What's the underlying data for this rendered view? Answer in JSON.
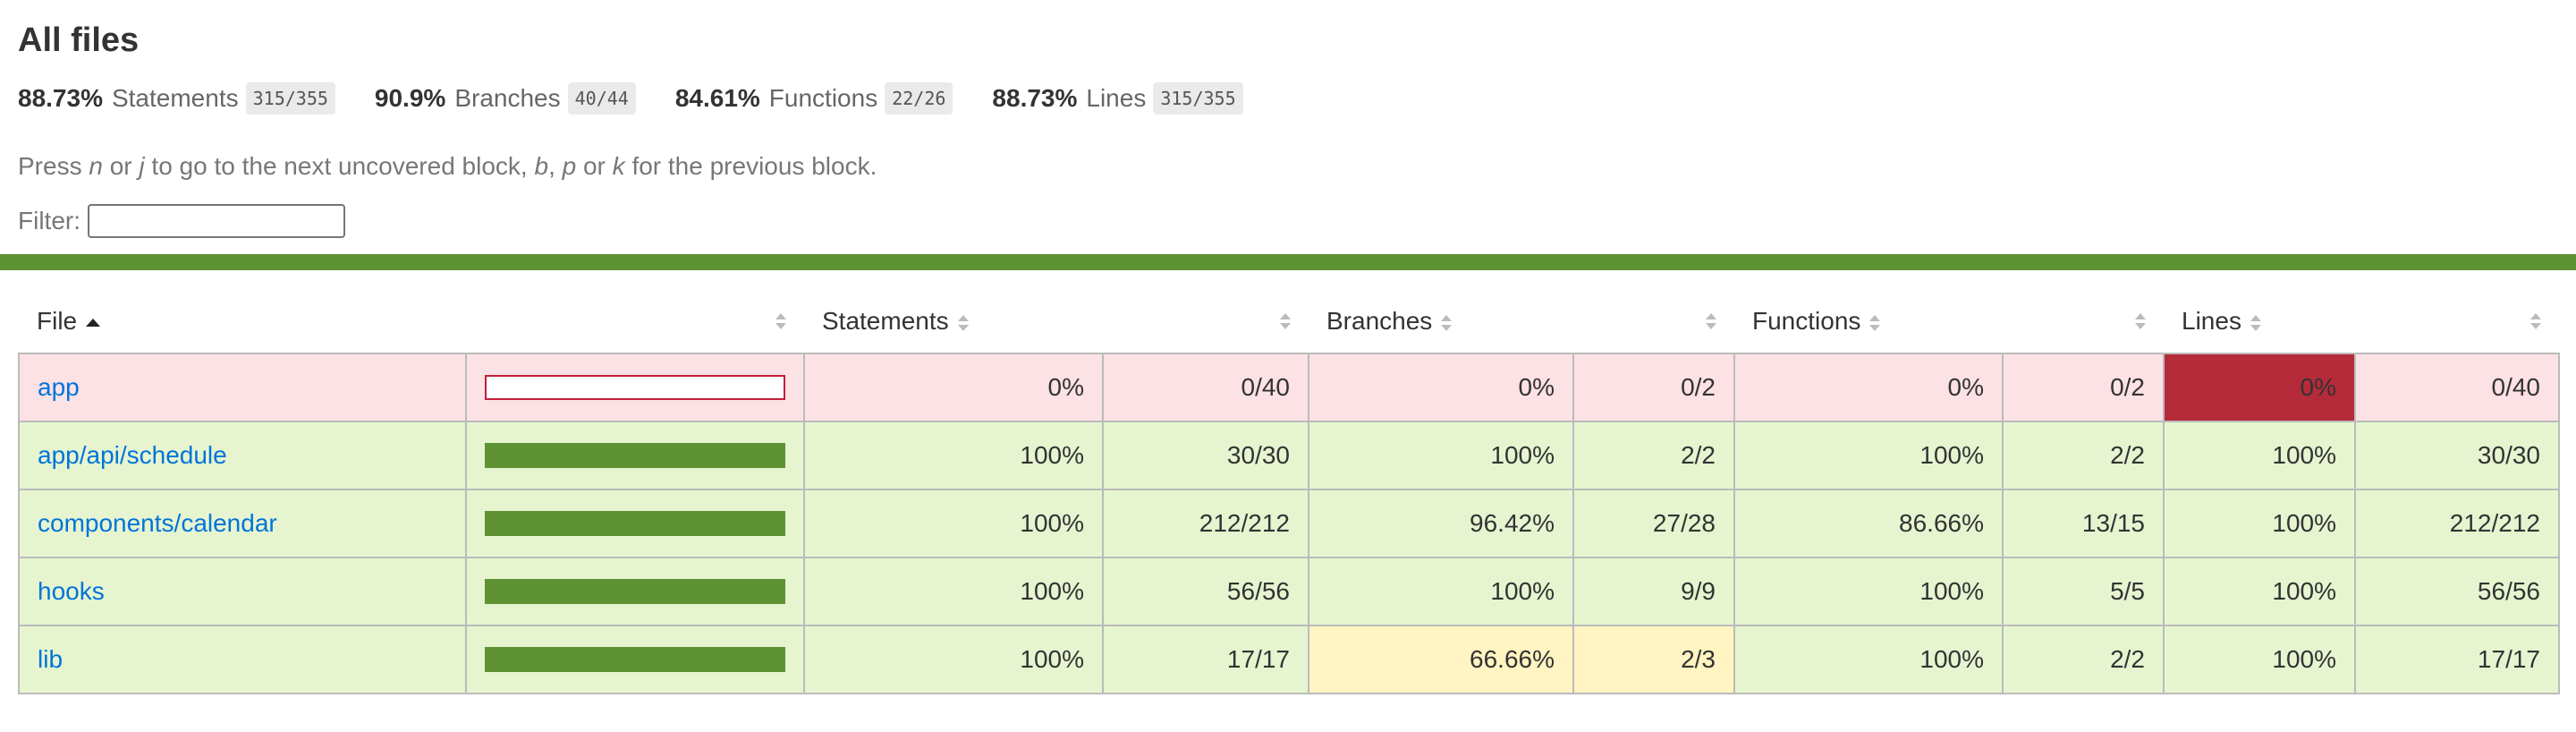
{
  "page": {
    "title": "All files"
  },
  "summary": [
    {
      "pct": "88.73%",
      "label": "Statements",
      "fraction": "315/355"
    },
    {
      "pct": "90.9%",
      "label": "Branches",
      "fraction": "40/44"
    },
    {
      "pct": "84.61%",
      "label": "Functions",
      "fraction": "22/26"
    },
    {
      "pct": "88.73%",
      "label": "Lines",
      "fraction": "315/355"
    }
  ],
  "help": {
    "t1": "Press ",
    "k1": "n",
    "t2": " or ",
    "k2": "j",
    "t3": " to go to the next uncovered block, ",
    "k3": "b",
    "t4": ", ",
    "k4": "p",
    "t5": " or ",
    "k5": "k",
    "t6": " for the previous block."
  },
  "filter": {
    "label": "Filter:",
    "value": ""
  },
  "table": {
    "headers": {
      "file": "File",
      "statements": "Statements",
      "branches": "Branches",
      "functions": "Functions",
      "lines": "Lines"
    },
    "rows": [
      {
        "file": "app",
        "level": "low",
        "coverage": 0,
        "statements_pct": "0%",
        "statements_frac": "0/40",
        "statements_level": "low",
        "branches_pct": "0%",
        "branches_frac": "0/2",
        "branches_level": "low",
        "functions_pct": "0%",
        "functions_frac": "0/2",
        "functions_level": "low",
        "lines_pct": "0%",
        "lines_frac": "0/40",
        "lines_level": "low-strong"
      },
      {
        "file": "app/api/schedule",
        "level": "high",
        "coverage": 100,
        "statements_pct": "100%",
        "statements_frac": "30/30",
        "statements_level": "high",
        "branches_pct": "100%",
        "branches_frac": "2/2",
        "branches_level": "high",
        "functions_pct": "100%",
        "functions_frac": "2/2",
        "functions_level": "high",
        "lines_pct": "100%",
        "lines_frac": "30/30",
        "lines_level": "high"
      },
      {
        "file": "components/calendar",
        "level": "high",
        "coverage": 100,
        "statements_pct": "100%",
        "statements_frac": "212/212",
        "statements_level": "high",
        "branches_pct": "96.42%",
        "branches_frac": "27/28",
        "branches_level": "high",
        "functions_pct": "86.66%",
        "functions_frac": "13/15",
        "functions_level": "high",
        "lines_pct": "100%",
        "lines_frac": "212/212",
        "lines_level": "high"
      },
      {
        "file": "hooks",
        "level": "high",
        "coverage": 100,
        "statements_pct": "100%",
        "statements_frac": "56/56",
        "statements_level": "high",
        "branches_pct": "100%",
        "branches_frac": "9/9",
        "branches_level": "high",
        "functions_pct": "100%",
        "functions_frac": "5/5",
        "functions_level": "high",
        "lines_pct": "100%",
        "lines_frac": "56/56",
        "lines_level": "high"
      },
      {
        "file": "lib",
        "level": "high",
        "coverage": 100,
        "statements_pct": "100%",
        "statements_frac": "17/17",
        "statements_level": "high",
        "branches_pct": "66.66%",
        "branches_frac": "2/3",
        "branches_level": "medium",
        "functions_pct": "100%",
        "functions_frac": "2/2",
        "functions_level": "high",
        "lines_pct": "100%",
        "lines_frac": "17/17",
        "lines_level": "high"
      }
    ]
  },
  "colors": {
    "accent": "#5f9232",
    "low": "#fce1e5",
    "high": "#e6f5d0",
    "medium": "#fff4c2",
    "link": "#0074d9"
  }
}
